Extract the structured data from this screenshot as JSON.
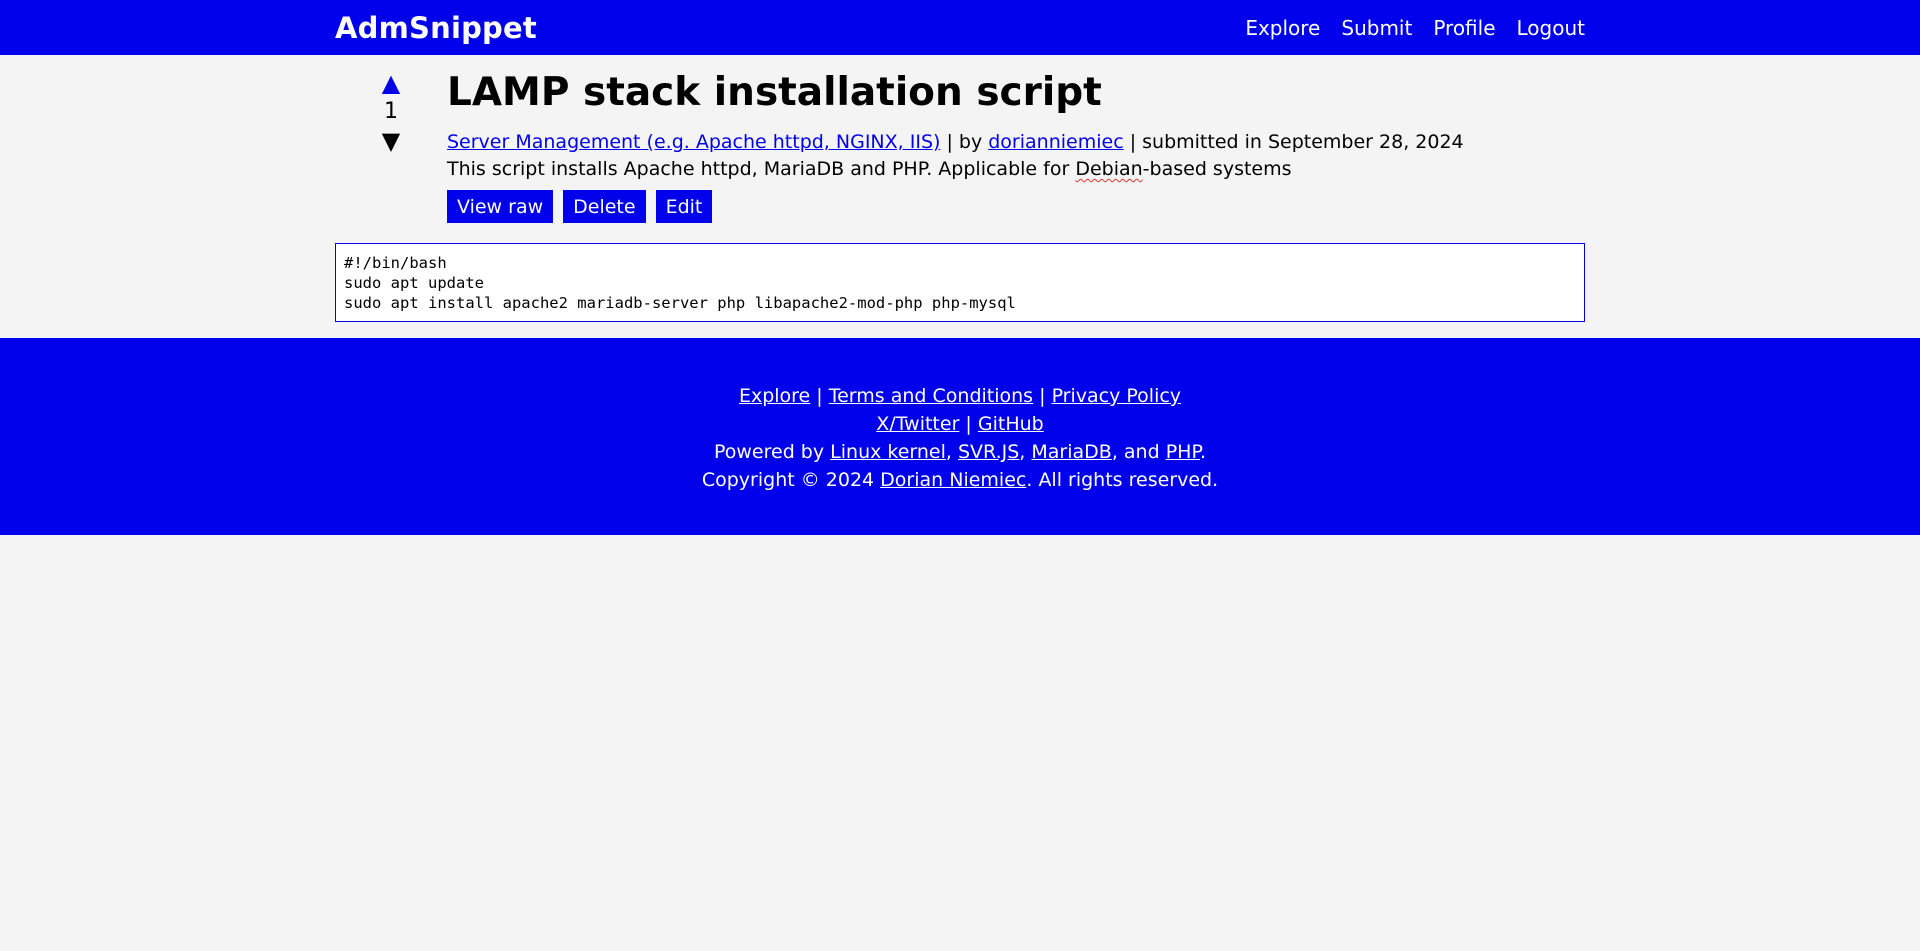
{
  "header": {
    "brand": "AdmSnippet",
    "nav": [
      "Explore",
      "Submit",
      "Profile",
      "Logout"
    ]
  },
  "snippet": {
    "vote_count": "1",
    "title": "LAMP stack installation script",
    "category": "Server Management (e.g. Apache httpd, NGINX, IIS)",
    "sep1": " | by ",
    "author": "dorianniemiec",
    "submitted": " | submitted in September 28, 2024",
    "desc_before": "This script installs Apache httpd, MariaDB and PHP. Applicable for ",
    "desc_word": "Debian",
    "desc_after": "-based systems",
    "actions": [
      "View raw",
      "Delete",
      "Edit"
    ],
    "code": "#!/bin/bash\nsudo apt update\nsudo apt install apache2 mariadb-server php libapache2-mod-php php-mysql"
  },
  "footer": {
    "links_row1": [
      "Explore",
      "Terms and Conditions",
      "Privacy Policy"
    ],
    "links_row2": [
      "X/Twitter",
      "GitHub"
    ],
    "powered_prefix": "Powered by ",
    "powered_links": [
      "Linux kernel",
      "SVR.JS",
      "MariaDB",
      "PHP"
    ],
    "copyright_prefix": "Copyright © 2024 ",
    "copyright_name": "Dorian Niemiec",
    "copyright_suffix": ". All rights reserved."
  },
  "colors": {
    "primary": "#0000ea",
    "background": "#f4f4f4"
  }
}
